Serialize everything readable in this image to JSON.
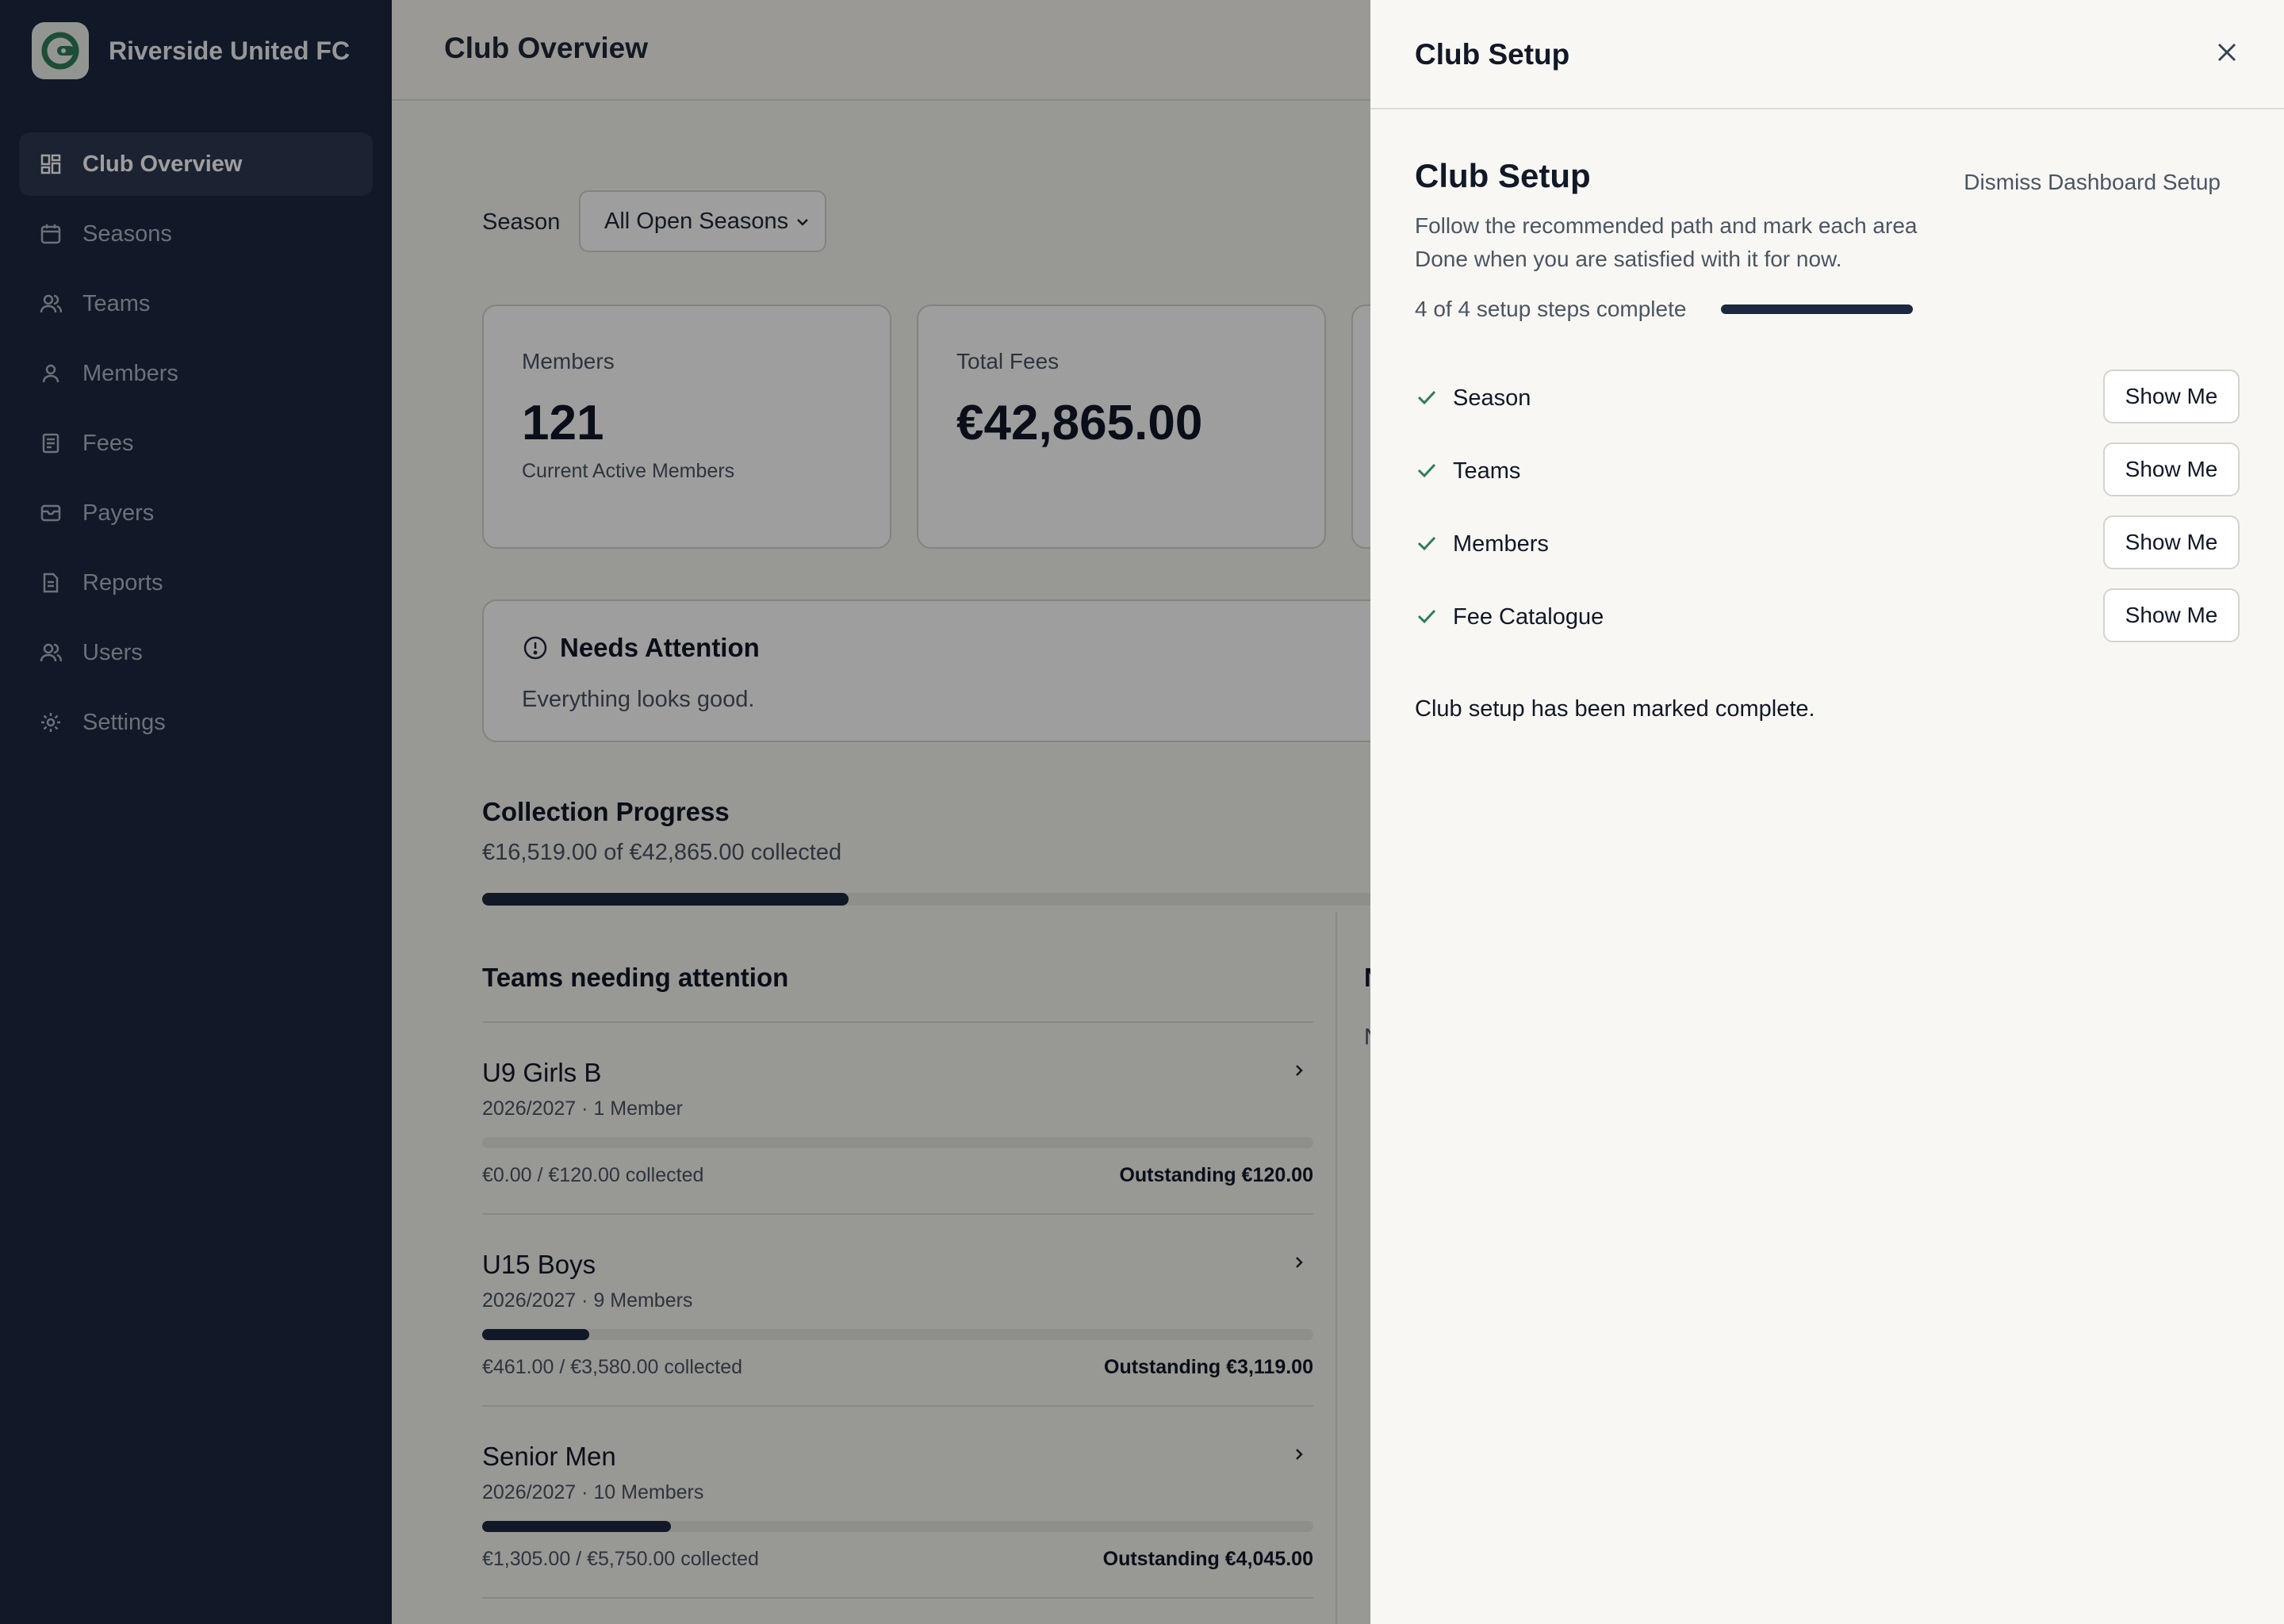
{
  "brand": {
    "name": "Riverside United FC",
    "logo_icon": "club-logo-icon"
  },
  "sidebar": {
    "items": [
      {
        "label": "Club Overview",
        "icon": "grid-icon",
        "active": true
      },
      {
        "label": "Seasons",
        "icon": "calendar-icon",
        "active": false
      },
      {
        "label": "Teams",
        "icon": "users-icon",
        "active": false
      },
      {
        "label": "Members",
        "icon": "user-icon",
        "active": false
      },
      {
        "label": "Fees",
        "icon": "receipt-icon",
        "active": false
      },
      {
        "label": "Payers",
        "icon": "wallet-icon",
        "active": false
      },
      {
        "label": "Reports",
        "icon": "document-icon",
        "active": false
      },
      {
        "label": "Users",
        "icon": "users-icon",
        "active": false
      },
      {
        "label": "Settings",
        "icon": "gear-icon",
        "active": false
      }
    ]
  },
  "main": {
    "title": "Club Overview",
    "season_filter": {
      "label": "Season",
      "value": "All Open Seasons"
    },
    "cards": [
      {
        "label": "Members",
        "value": "121",
        "sub": "Current Active Members"
      },
      {
        "label": "Total Fees",
        "value": "€42,865.00",
        "sub": ""
      }
    ],
    "attention": {
      "title": "Needs Attention",
      "text": "Everything looks good."
    },
    "collection": {
      "title": "Collection Progress",
      "summary": "€16,519.00 of €42,865.00 collected",
      "collected": 16519.0,
      "total": 42865.0
    },
    "teams_section": {
      "title": "Teams needing attention"
    },
    "side_column": {
      "head": "N",
      "text": "N"
    },
    "teams": [
      {
        "name": "U9 Girls B",
        "meta": "2026/2027 · 1 Member",
        "collected_text": "€0.00 / €120.00 collected",
        "outstanding": "Outstanding €120.00",
        "collected": 0.0,
        "total": 120.0
      },
      {
        "name": "U15 Boys",
        "meta": "2026/2027 · 9 Members",
        "collected_text": "€461.00 / €3,580.00 collected",
        "outstanding": "Outstanding €3,119.00",
        "collected": 461.0,
        "total": 3580.0
      },
      {
        "name": "Senior Men",
        "meta": "2026/2027 · 10 Members",
        "collected_text": "€1,305.00 / €5,750.00 collected",
        "outstanding": "Outstanding €4,045.00",
        "collected": 1305.0,
        "total": 5750.0
      }
    ]
  },
  "drawer": {
    "title": "Club Setup",
    "setup_title": "Club Setup",
    "dismiss": "Dismiss Dashboard Setup",
    "description": "Follow the recommended path and mark each area Done when you are satisfied with it for now.",
    "progress_text": "4 of 4 setup steps complete",
    "steps_done": 4,
    "steps_total": 4,
    "steps": [
      {
        "label": "Season",
        "button": "Show Me"
      },
      {
        "label": "Teams",
        "button": "Show Me"
      },
      {
        "label": "Members",
        "button": "Show Me"
      },
      {
        "label": "Fee Catalogue",
        "button": "Show Me"
      }
    ],
    "complete_note": "Club setup has been marked complete."
  },
  "colors": {
    "sidebar_bg": "#1c2740",
    "accent": "#1c2740",
    "check": "#2f7d5a"
  }
}
